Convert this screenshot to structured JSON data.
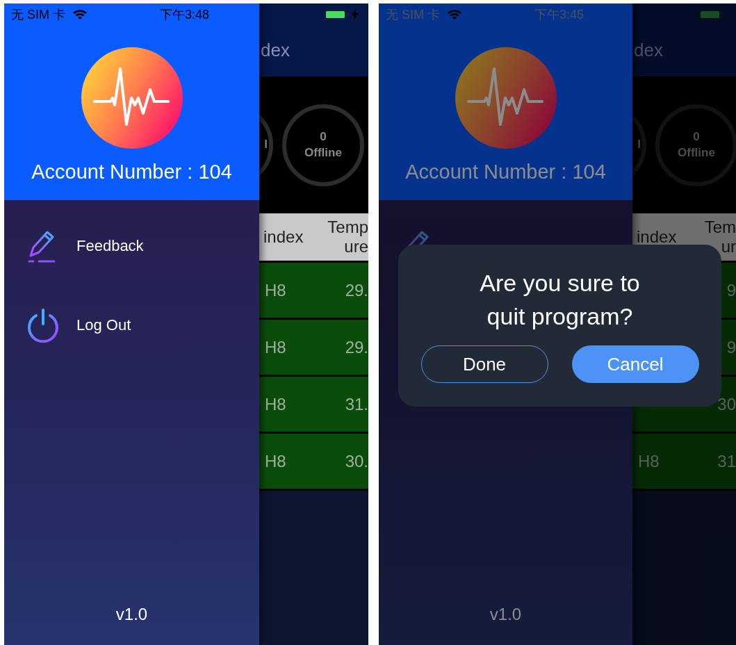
{
  "phones": [
    {
      "status_bar": {
        "carrier": "无 SIM 卡",
        "time": "下午3:48",
        "charging": true
      },
      "drawer": {
        "account": "Account Number : 104",
        "menu": [
          {
            "kind": "feedback",
            "label": "Feedback"
          },
          {
            "kind": "logout",
            "label": "Log Out"
          }
        ],
        "version": "v1.0"
      },
      "main": {
        "title": "dex",
        "stats": [
          {
            "label": "l"
          },
          {
            "count": "0",
            "label": "Offline"
          }
        ],
        "table": {
          "columns": [
            "index",
            "Temp\nure"
          ],
          "rows": [
            {
              "index": "H8",
              "temperature": "29."
            },
            {
              "index": "H8",
              "temperature": "29."
            },
            {
              "index": "H8",
              "temperature": "31."
            },
            {
              "index": "H8",
              "temperature": "30."
            }
          ]
        }
      }
    },
    {
      "status_bar": {
        "carrier": "无 SIM 卡",
        "time": "下午3:45",
        "charging": false
      },
      "drawer": {
        "account": "Account Number : 104",
        "menu": [
          {
            "kind": "feedback"
          }
        ],
        "version": "v1.0"
      },
      "main": {
        "title": "dex",
        "stats": [
          {
            "label": "l"
          },
          {
            "count": "0",
            "label": "Offline"
          }
        ],
        "table": {
          "columns": [
            "index",
            "Tem\nur"
          ],
          "rows": [
            {
              "temperature": "9"
            },
            {
              "temperature": "9"
            },
            {
              "temperature": "30"
            },
            {
              "index": "H8",
              "temperature": "31"
            }
          ]
        }
      },
      "dialog": {
        "message": "Are you sure to quit program?",
        "buttons": [
          {
            "label": "Done",
            "kind": "outline"
          },
          {
            "label": "Cancel",
            "kind": "filled"
          }
        ]
      }
    }
  ]
}
